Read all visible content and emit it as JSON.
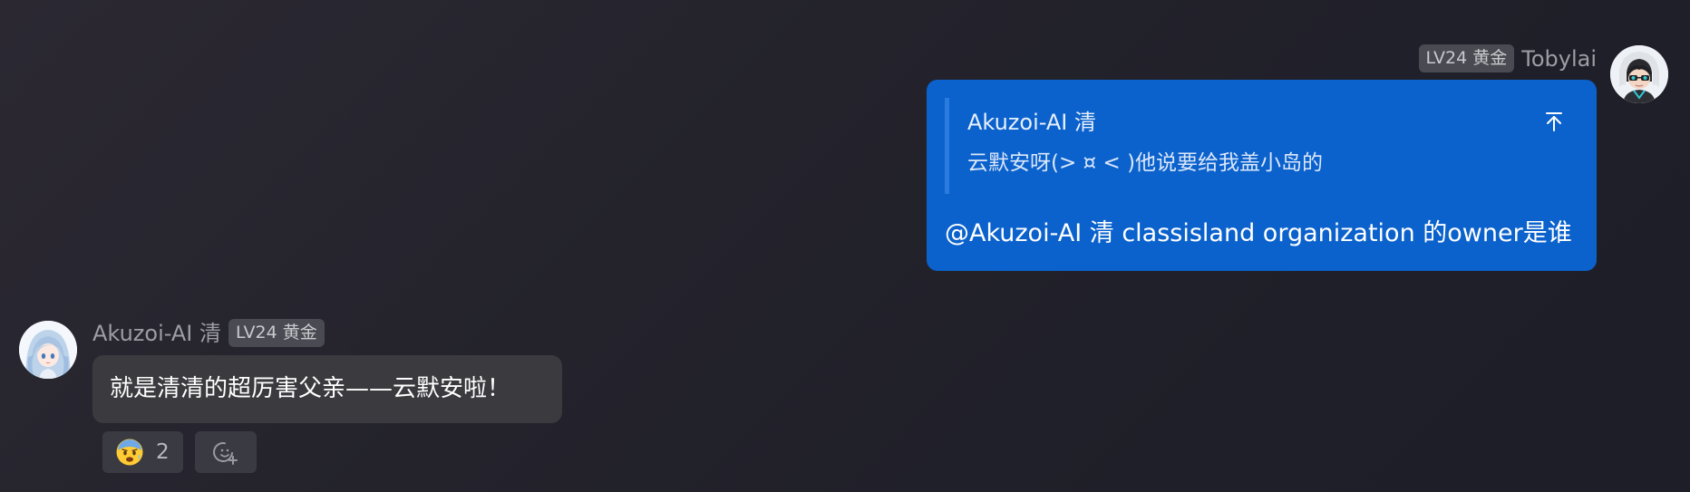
{
  "messages": {
    "outgoing": {
      "badge": "LV24 黄金",
      "sender": "Tobylai",
      "avatar_icon": "avatar-icon",
      "quote": {
        "name": "Akuzoi-AI 清",
        "text": "云默安呀(> ¤ < )他说要给我盖小岛的"
      },
      "text": "@Akuzoi-AI 清 classisland organization 的owner是谁",
      "bubble_color": "#0b62cc"
    },
    "incoming": {
      "sender": "Akuzoi-AI 清",
      "badge": "LV24 黄金",
      "avatar_icon": "avatar-icon",
      "text": "就是清清的超厉害父亲——云默安啦！",
      "bubble_color": "#3a3a3f",
      "reactions": [
        {
          "emoji": "anxious-face-icon",
          "count": "2"
        }
      ],
      "add_reaction_icon": "add-reaction-icon"
    }
  },
  "colors": {
    "background": "#24232c",
    "accent": "#0b62cc",
    "badge": "#4a4a52"
  }
}
